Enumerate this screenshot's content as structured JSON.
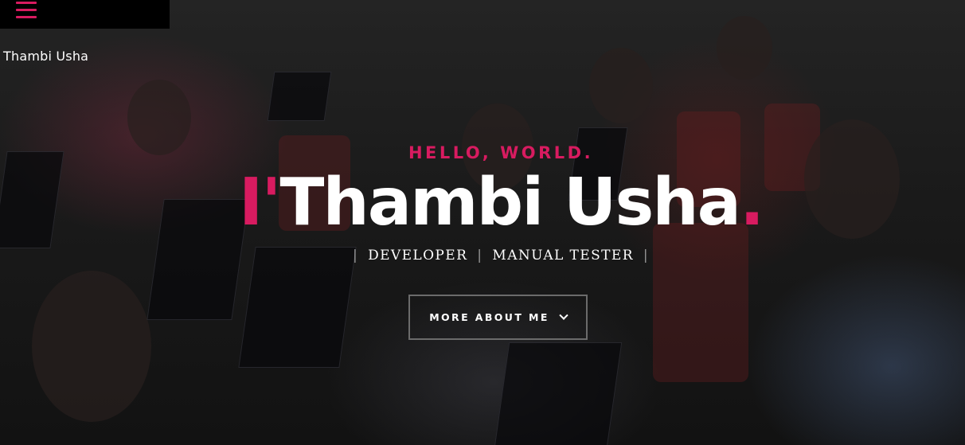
{
  "header": {
    "menu_icon": "hamburger-icon",
    "menu_icon_color": "#d81b60",
    "brand": "Thambi Usha"
  },
  "intro": {
    "greeting": "HELLO, WORLD.",
    "name_prefix": "I'",
    "name": "Thambi Usha",
    "name_suffix": ".",
    "roles": [
      "DEVELOPER",
      "MANUAL TESTER"
    ],
    "separator": "|",
    "cta_label": "MORE ABOUT ME",
    "cta_icon": "chevron-down-icon"
  },
  "colors": {
    "accent": "#d81b60",
    "text": "#ffffff",
    "button_border": "#6b6b6b",
    "menu_bg": "#000000"
  }
}
